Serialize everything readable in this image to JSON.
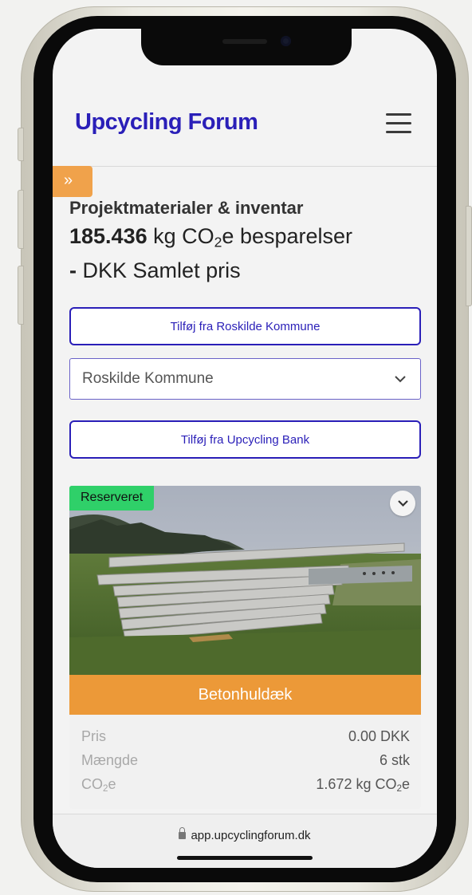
{
  "header": {
    "logo_text": "Upcycling Forum"
  },
  "sidebar_toggle": {
    "icon": "double-chevron-right-icon",
    "glyph": "»"
  },
  "project": {
    "title": "Projektmaterialer & inventar",
    "co2_value": "185.436",
    "co2_unit_prefix": "kg CO",
    "co2_unit_sub": "2",
    "co2_unit_suffix": "e besparelser",
    "price_value": "-",
    "price_label": "DKK Samlet pris"
  },
  "actions": {
    "add_from_municipality": "Tilføj fra Roskilde Kommune",
    "municipality_select_value": "Roskilde Kommune",
    "add_from_bank": "Tilføj fra Upcycling Bank"
  },
  "material_card": {
    "status_badge": "Reserveret",
    "name": "Betonhuldæk",
    "stats": [
      {
        "label": "Pris",
        "value": "0.00 DKK"
      },
      {
        "label": "Mængde",
        "value": "6 stk"
      },
      {
        "label_prefix": "CO",
        "label_sub": "2",
        "label_suffix": "e",
        "value_prefix": "1.672 kg CO",
        "value_sub": "2",
        "value_suffix": "e"
      }
    ]
  },
  "browser": {
    "url": "app.upcyclingforum.dk"
  },
  "colors": {
    "brand": "#2a1fb8",
    "accent_orange": "#ec9938",
    "status_green": "#2fd069"
  }
}
